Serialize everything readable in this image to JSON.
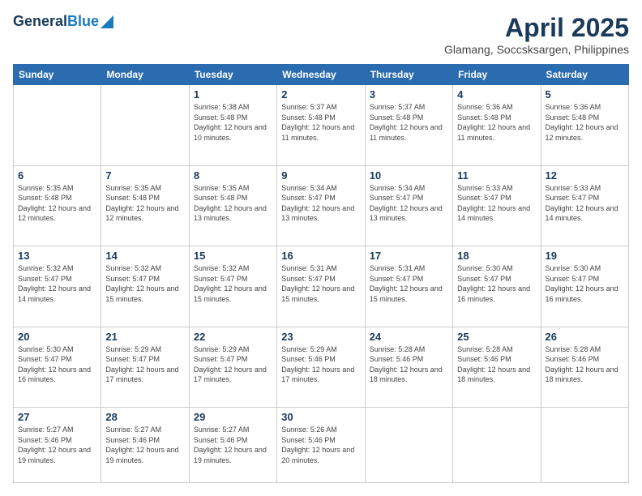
{
  "logo": {
    "general": "General",
    "blue": "Blue"
  },
  "title": "April 2025",
  "location": "Glamang, Soccsksargen, Philippines",
  "days_of_week": [
    "Sunday",
    "Monday",
    "Tuesday",
    "Wednesday",
    "Thursday",
    "Friday",
    "Saturday"
  ],
  "weeks": [
    [
      {
        "day": "",
        "info": ""
      },
      {
        "day": "",
        "info": ""
      },
      {
        "day": "1",
        "info": "Sunrise: 5:38 AM\nSunset: 5:48 PM\nDaylight: 12 hours\nand 10 minutes."
      },
      {
        "day": "2",
        "info": "Sunrise: 5:37 AM\nSunset: 5:48 PM\nDaylight: 12 hours\nand 11 minutes."
      },
      {
        "day": "3",
        "info": "Sunrise: 5:37 AM\nSunset: 5:48 PM\nDaylight: 12 hours\nand 11 minutes."
      },
      {
        "day": "4",
        "info": "Sunrise: 5:36 AM\nSunset: 5:48 PM\nDaylight: 12 hours\nand 11 minutes."
      },
      {
        "day": "5",
        "info": "Sunrise: 5:36 AM\nSunset: 5:48 PM\nDaylight: 12 hours\nand 12 minutes."
      }
    ],
    [
      {
        "day": "6",
        "info": "Sunrise: 5:35 AM\nSunset: 5:48 PM\nDaylight: 12 hours\nand 12 minutes."
      },
      {
        "day": "7",
        "info": "Sunrise: 5:35 AM\nSunset: 5:48 PM\nDaylight: 12 hours\nand 12 minutes."
      },
      {
        "day": "8",
        "info": "Sunrise: 5:35 AM\nSunset: 5:48 PM\nDaylight: 12 hours\nand 13 minutes."
      },
      {
        "day": "9",
        "info": "Sunrise: 5:34 AM\nSunset: 5:47 PM\nDaylight: 12 hours\nand 13 minutes."
      },
      {
        "day": "10",
        "info": "Sunrise: 5:34 AM\nSunset: 5:47 PM\nDaylight: 12 hours\nand 13 minutes."
      },
      {
        "day": "11",
        "info": "Sunrise: 5:33 AM\nSunset: 5:47 PM\nDaylight: 12 hours\nand 14 minutes."
      },
      {
        "day": "12",
        "info": "Sunrise: 5:33 AM\nSunset: 5:47 PM\nDaylight: 12 hours\nand 14 minutes."
      }
    ],
    [
      {
        "day": "13",
        "info": "Sunrise: 5:32 AM\nSunset: 5:47 PM\nDaylight: 12 hours\nand 14 minutes."
      },
      {
        "day": "14",
        "info": "Sunrise: 5:32 AM\nSunset: 5:47 PM\nDaylight: 12 hours\nand 15 minutes."
      },
      {
        "day": "15",
        "info": "Sunrise: 5:32 AM\nSunset: 5:47 PM\nDaylight: 12 hours\nand 15 minutes."
      },
      {
        "day": "16",
        "info": "Sunrise: 5:31 AM\nSunset: 5:47 PM\nDaylight: 12 hours\nand 15 minutes."
      },
      {
        "day": "17",
        "info": "Sunrise: 5:31 AM\nSunset: 5:47 PM\nDaylight: 12 hours\nand 15 minutes."
      },
      {
        "day": "18",
        "info": "Sunrise: 5:30 AM\nSunset: 5:47 PM\nDaylight: 12 hours\nand 16 minutes."
      },
      {
        "day": "19",
        "info": "Sunrise: 5:30 AM\nSunset: 5:47 PM\nDaylight: 12 hours\nand 16 minutes."
      }
    ],
    [
      {
        "day": "20",
        "info": "Sunrise: 5:30 AM\nSunset: 5:47 PM\nDaylight: 12 hours\nand 16 minutes."
      },
      {
        "day": "21",
        "info": "Sunrise: 5:29 AM\nSunset: 5:47 PM\nDaylight: 12 hours\nand 17 minutes."
      },
      {
        "day": "22",
        "info": "Sunrise: 5:29 AM\nSunset: 5:47 PM\nDaylight: 12 hours\nand 17 minutes."
      },
      {
        "day": "23",
        "info": "Sunrise: 5:29 AM\nSunset: 5:46 PM\nDaylight: 12 hours\nand 17 minutes."
      },
      {
        "day": "24",
        "info": "Sunrise: 5:28 AM\nSunset: 5:46 PM\nDaylight: 12 hours\nand 18 minutes."
      },
      {
        "day": "25",
        "info": "Sunrise: 5:28 AM\nSunset: 5:46 PM\nDaylight: 12 hours\nand 18 minutes."
      },
      {
        "day": "26",
        "info": "Sunrise: 5:28 AM\nSunset: 5:46 PM\nDaylight: 12 hours\nand 18 minutes."
      }
    ],
    [
      {
        "day": "27",
        "info": "Sunrise: 5:27 AM\nSunset: 5:46 PM\nDaylight: 12 hours\nand 19 minutes."
      },
      {
        "day": "28",
        "info": "Sunrise: 5:27 AM\nSunset: 5:46 PM\nDaylight: 12 hours\nand 19 minutes."
      },
      {
        "day": "29",
        "info": "Sunrise: 5:27 AM\nSunset: 5:46 PM\nDaylight: 12 hours\nand 19 minutes."
      },
      {
        "day": "30",
        "info": "Sunrise: 5:26 AM\nSunset: 5:46 PM\nDaylight: 12 hours\nand 20 minutes."
      },
      {
        "day": "",
        "info": ""
      },
      {
        "day": "",
        "info": ""
      },
      {
        "day": "",
        "info": ""
      }
    ]
  ]
}
